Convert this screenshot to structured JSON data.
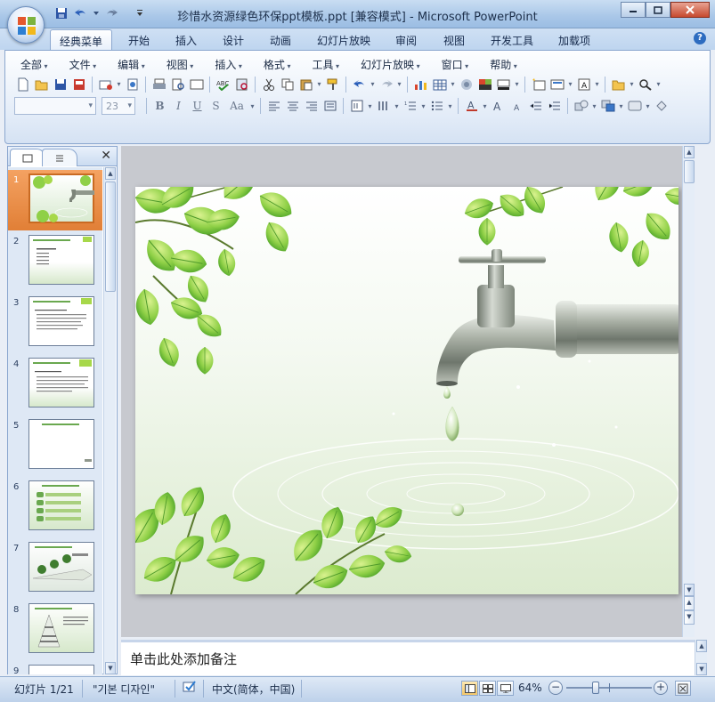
{
  "window": {
    "title": "珍惜水资源绿色环保ppt模板.ppt [兼容模式] - Microsoft PowerPoint",
    "controls": [
      "minimize-icon",
      "maximize-icon",
      "close-icon"
    ]
  },
  "quick_access": [
    "save-icon",
    "undo-icon",
    "redo-icon",
    "customize-icon"
  ],
  "ribbon_tabs": [
    {
      "label": "经典菜单",
      "active": true
    },
    {
      "label": "开始"
    },
    {
      "label": "插入"
    },
    {
      "label": "设计"
    },
    {
      "label": "动画"
    },
    {
      "label": "幻灯片放映"
    },
    {
      "label": "审阅"
    },
    {
      "label": "视图"
    },
    {
      "label": "开发工具"
    },
    {
      "label": "加载项"
    }
  ],
  "classic_menu": [
    "全部",
    "文件",
    "编辑",
    "视图",
    "插入",
    "格式",
    "工具",
    "幻灯片放映",
    "窗口",
    "帮助"
  ],
  "font": {
    "name": "",
    "size": "23"
  },
  "format_buttons": [
    "B",
    "I",
    "U",
    "S",
    "Aa"
  ],
  "slides": [
    {
      "num": "1",
      "selected": true
    },
    {
      "num": "2"
    },
    {
      "num": "3"
    },
    {
      "num": "4"
    },
    {
      "num": "5"
    },
    {
      "num": "6"
    },
    {
      "num": "7"
    },
    {
      "num": "8"
    },
    {
      "num": "9"
    }
  ],
  "notes_placeholder": "单击此处添加备注",
  "status": {
    "slide_info": "幻灯片 1/21",
    "theme": "\"기본 디자인\"",
    "language": "中文(简体，中国)",
    "zoom": "64%",
    "zoom_level": 0.64
  },
  "colors": {
    "accent_orange": "#e17f36",
    "ribbon_blue": "#bed5ef",
    "leaf_green": "#7cc43a"
  }
}
